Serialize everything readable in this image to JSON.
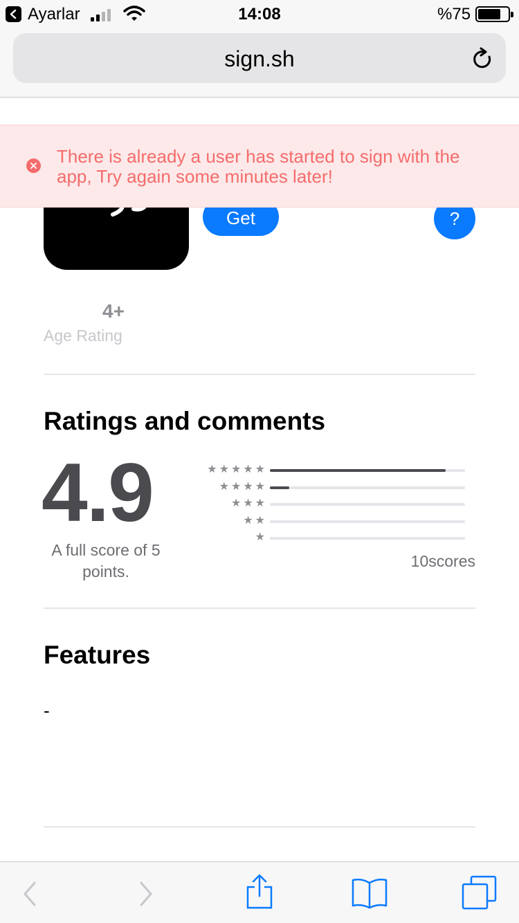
{
  "status_bar": {
    "carrier": "Ayarlar",
    "time": "14:08",
    "battery": "%75",
    "battery_level": 0.75,
    "signal_bars_filled": 2,
    "signal_bars_total": 4
  },
  "browser": {
    "url": "sign.sh"
  },
  "alert": {
    "message": "There is already a user has started to sign with the app, Try again some minutes later!",
    "color": "#f56c6c"
  },
  "app": {
    "get_label": "Get",
    "help_label": "?",
    "age_value": "4+",
    "age_label": "Age Rating"
  },
  "ratings": {
    "title": "Ratings and comments",
    "average": "4.9",
    "caption": "A full score of 5 points.",
    "count_label": "10scores",
    "distribution": [
      {
        "stars": "★★★★★",
        "fraction": 0.9
      },
      {
        "stars": "★★★★",
        "fraction": 0.1
      },
      {
        "stars": "★★★",
        "fraction": 0
      },
      {
        "stars": "★★",
        "fraction": 0
      },
      {
        "stars": "★",
        "fraction": 0
      }
    ]
  },
  "features": {
    "title": "Features",
    "text": "-"
  },
  "toolbar": {
    "icons": [
      "back-icon",
      "forward-icon",
      "share-icon",
      "bookmarks-icon",
      "tabs-icon"
    ]
  },
  "colors": {
    "accent": "#0a7aff",
    "score": "#4a4a4f"
  }
}
